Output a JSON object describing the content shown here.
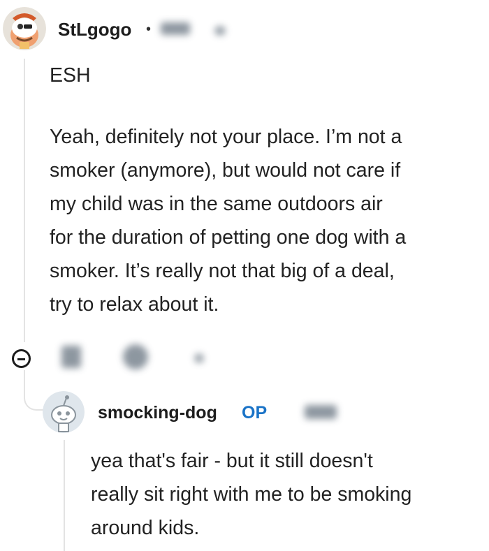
{
  "comment": {
    "username": "StLgogo",
    "separator": "•",
    "verdict": "ESH",
    "body": "Yeah, definitely not your place. I’m not a\nsmoker (anymore), but would not care if\nmy child was in the same outdoors air\nfor the duration of petting one dog with a\nsmoker. It’s really not that big of a deal,\ntry to relax about it.",
    "avatar_icon": "snoo-avatar-icon"
  },
  "reply": {
    "username": "smocking-dog",
    "op_badge": "OP",
    "body": "yea that's fair - but it still doesn't\nreally sit right with me to be smoking\naround kids.",
    "avatar_icon": "snoo-avatar-icon"
  },
  "colors": {
    "op_badge": "#1a73c7",
    "thread_line": "#e3e3e3",
    "text": "#222222"
  }
}
